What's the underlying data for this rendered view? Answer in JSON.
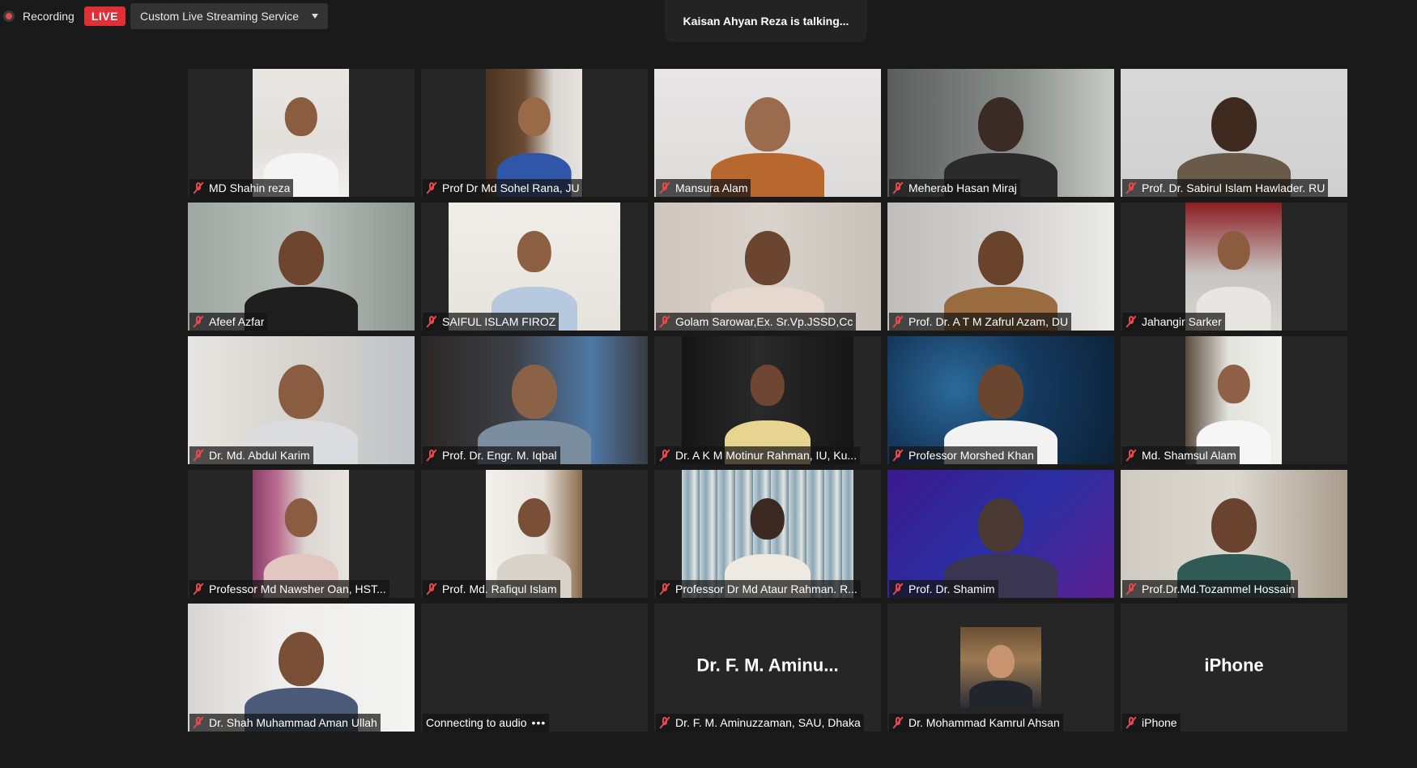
{
  "topbar": {
    "recording_label": "Recording",
    "live_label": "LIVE",
    "stream_label": "Custom Live Streaming Service"
  },
  "speaker_banner": "Kaisan Ahyan Reza is talking...",
  "colors": {
    "background": "#1a1a1a",
    "tile_background": "#262626",
    "live_red": "#e02f35",
    "muted_icon_red": "#e5484d"
  },
  "participants": [
    {
      "name": "MD Shahin reza",
      "muted": true
    },
    {
      "name": "Prof Dr Md Sohel Rana, JU",
      "muted": true
    },
    {
      "name": "Mansura Alam",
      "muted": true
    },
    {
      "name": "Meherab Hasan Miraj",
      "muted": true
    },
    {
      "name": "Prof. Dr. Sabirul Islam Hawlader. RU",
      "muted": true
    },
    {
      "name": "Afeef Azfar",
      "muted": true
    },
    {
      "name": "SAIFUL ISLAM FIROZ",
      "muted": true
    },
    {
      "name": "Golam Sarowar,Ex. Sr.Vp.JSSD,Cc",
      "muted": true
    },
    {
      "name": "Prof. Dr. A T M Zafrul Azam, DU",
      "muted": true
    },
    {
      "name": "Jahangir Sarker",
      "muted": true
    },
    {
      "name": "Dr. Md. Abdul Karim",
      "muted": true
    },
    {
      "name": "Prof. Dr.  Engr. M. Iqbal",
      "muted": true
    },
    {
      "name": "Dr. A K M Motinur Rahman, IU, Ku...",
      "muted": true
    },
    {
      "name": "Professor Morshed Khan",
      "muted": true
    },
    {
      "name": "Md. Shamsul Alam",
      "muted": true
    },
    {
      "name": "Professor Md Nawsher Oan,  HST...",
      "muted": true
    },
    {
      "name": "Prof. Md. Rafiqul Islam",
      "muted": true
    },
    {
      "name": "Professor Dr Md  Ataur Rahman. R...",
      "muted": true
    },
    {
      "name": "Prof. Dr. Shamim",
      "muted": true
    },
    {
      "name": "Prof.Dr.Md.Tozammel Hossain",
      "muted": true
    },
    {
      "name": "Dr. Shah Muhammad Aman Ullah",
      "muted": true
    },
    {
      "name": "Connecting to audio",
      "status": "connecting"
    },
    {
      "name": "Dr. F. M. Aminuzzaman, SAU, Dhaka",
      "muted": true,
      "display_name": "Dr. F. M. Aminu..."
    },
    {
      "name": "Dr. Mohammad Kamrul Ahsan",
      "muted": true
    },
    {
      "name": "iPhone",
      "muted": true,
      "display_name": "iPhone"
    }
  ],
  "connecting_dots": "•••"
}
